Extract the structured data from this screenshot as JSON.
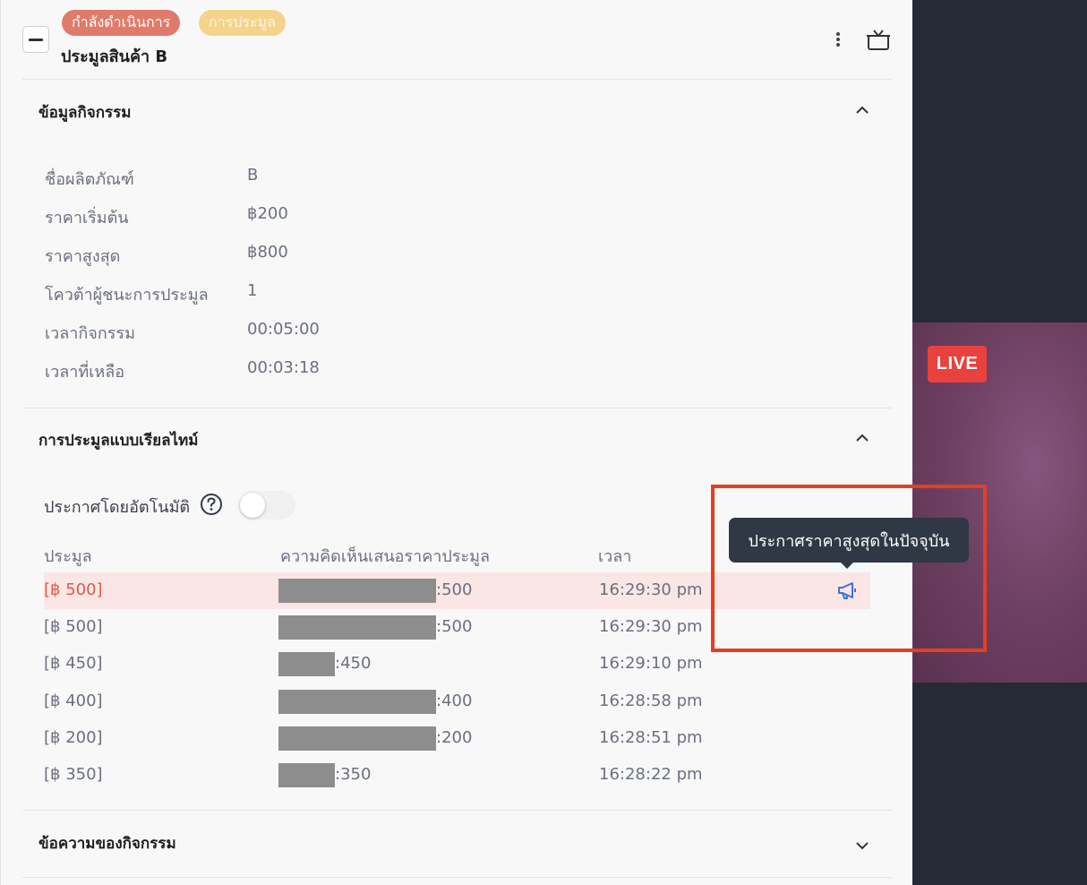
{
  "header": {
    "status_badge": "กำลังดำเนินการ",
    "type_badge": "การประมูล",
    "title": "ประมูลสินค้า B",
    "colors": {
      "status": "#e07b6b",
      "type": "#f4d48b"
    },
    "icons": [
      "more-vertical-icon",
      "gift-box-icon"
    ]
  },
  "activity_info": {
    "title": "ข้อมูลกิจกรรม",
    "rows": [
      {
        "label": "ชื่อผลิตภัณฑ์",
        "value": "B"
      },
      {
        "label": "ราคาเริ่มต้น",
        "value": "฿200"
      },
      {
        "label": "ราคาสูงสุด",
        "value": "฿800"
      },
      {
        "label": "โควต้าผู้ชนะการประมูล",
        "value": "1"
      },
      {
        "label": "เวลากิจกรรม",
        "value": "00:05:00"
      },
      {
        "label": "เวลาที่เหลือ",
        "value": "00:03:18"
      }
    ]
  },
  "realtime": {
    "title": "การประมูลแบบเรียลไทม์",
    "auto_announce_label": "ประกาศโดยอัตโนมัติ",
    "auto_announce_on": false,
    "columns": [
      "ประมูล",
      "ความคิดเห็นเสนอราคาประมูล",
      "เวลา"
    ],
    "rows": [
      {
        "bid": "[฿ 500]",
        "comment": ":500",
        "time": "16:29:30 pm"
      },
      {
        "bid": "[฿ 500]",
        "comment": ":500",
        "time": "16:29:30 pm"
      },
      {
        "bid": "[฿ 450]",
        "comment": ":450",
        "time": "16:29:10 pm"
      },
      {
        "bid": "[฿ 400]",
        "comment": ":400",
        "time": "16:28:58 pm"
      },
      {
        "bid": "[฿ 200]",
        "comment": ":200",
        "time": "16:28:51 pm"
      },
      {
        "bid": "[฿ 350]",
        "comment": ":350",
        "time": "16:28:22 pm"
      }
    ],
    "tooltip": "ประกาศราคาสูงสุดในปัจจุบัน",
    "highlight_color": "#fae6e4"
  },
  "messages": {
    "title": "ข้อความของกิจกรรม"
  },
  "live_badge": "LIVE"
}
